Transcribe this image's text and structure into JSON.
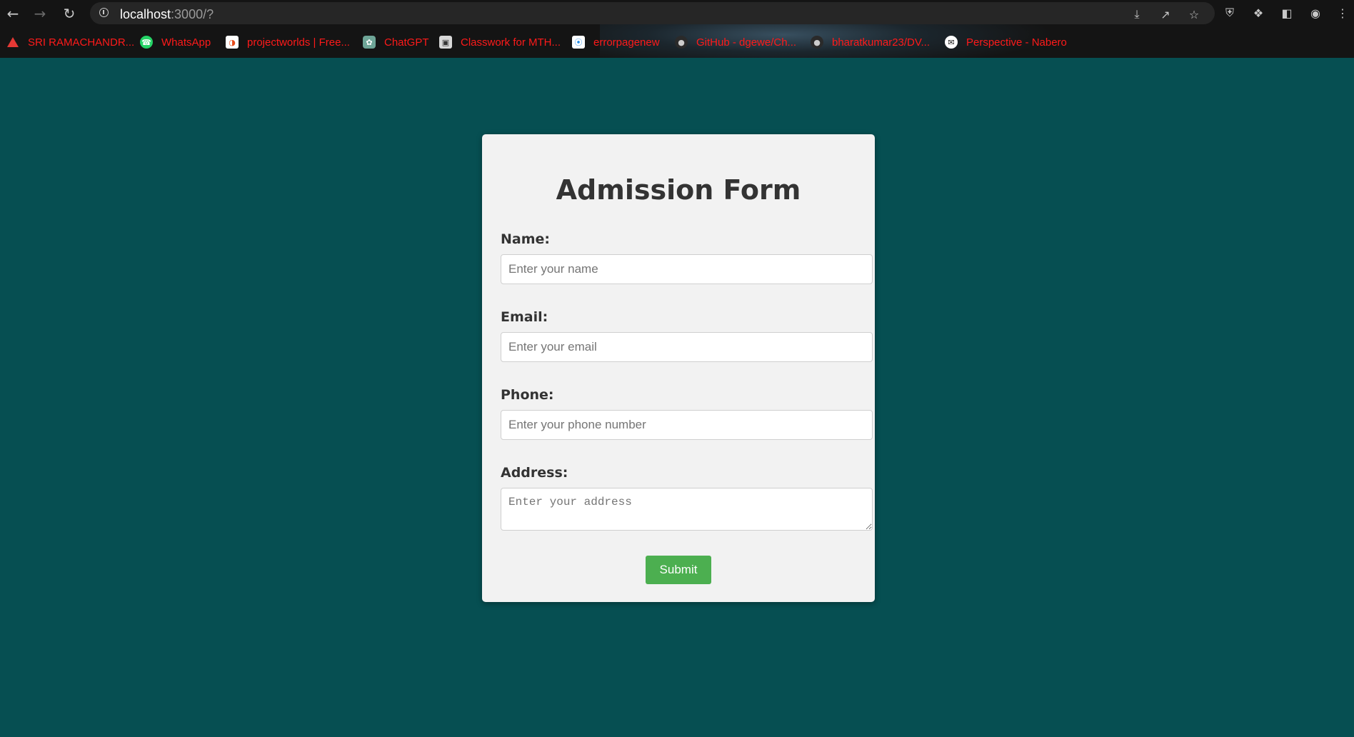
{
  "browser": {
    "url_host": "localhost",
    "url_path": ":3000/?",
    "nav": {
      "back_icon": "arrow-left-icon",
      "forward_icon": "arrow-right-icon",
      "reload_icon": "reload-icon"
    },
    "bookmarks": [
      {
        "label": "SRI RAMACHANDR...",
        "icon": "warning-triangle-icon"
      },
      {
        "label": "WhatsApp",
        "icon": "whatsapp-icon"
      },
      {
        "label": "projectworlds | Free...",
        "icon": "projectworlds-icon"
      },
      {
        "label": "ChatGPT",
        "icon": "chatgpt-icon"
      },
      {
        "label": "Classwork for MTH...",
        "icon": "classroom-icon"
      },
      {
        "label": "errorpagenew",
        "icon": "errorpage-icon"
      },
      {
        "label": "GitHub - dgewe/Ch...",
        "icon": "github-icon"
      },
      {
        "label": "bharatkumar23/DV...",
        "icon": "github-icon"
      },
      {
        "label": "Perspective - Nabero",
        "icon": "perspective-icon"
      }
    ],
    "colors": {
      "bookmark_text": "#ff1a1a",
      "page_background": "#064f52",
      "submit_button": "#4caf50"
    }
  },
  "form": {
    "title": "Admission Form",
    "fields": [
      {
        "label": "Name:",
        "placeholder": "Enter your name"
      },
      {
        "label": "Email:",
        "placeholder": "Enter your email"
      },
      {
        "label": "Phone:",
        "placeholder": "Enter your phone number"
      },
      {
        "label": "Address:",
        "placeholder": "Enter your address"
      }
    ],
    "submit_label": "Submit"
  }
}
